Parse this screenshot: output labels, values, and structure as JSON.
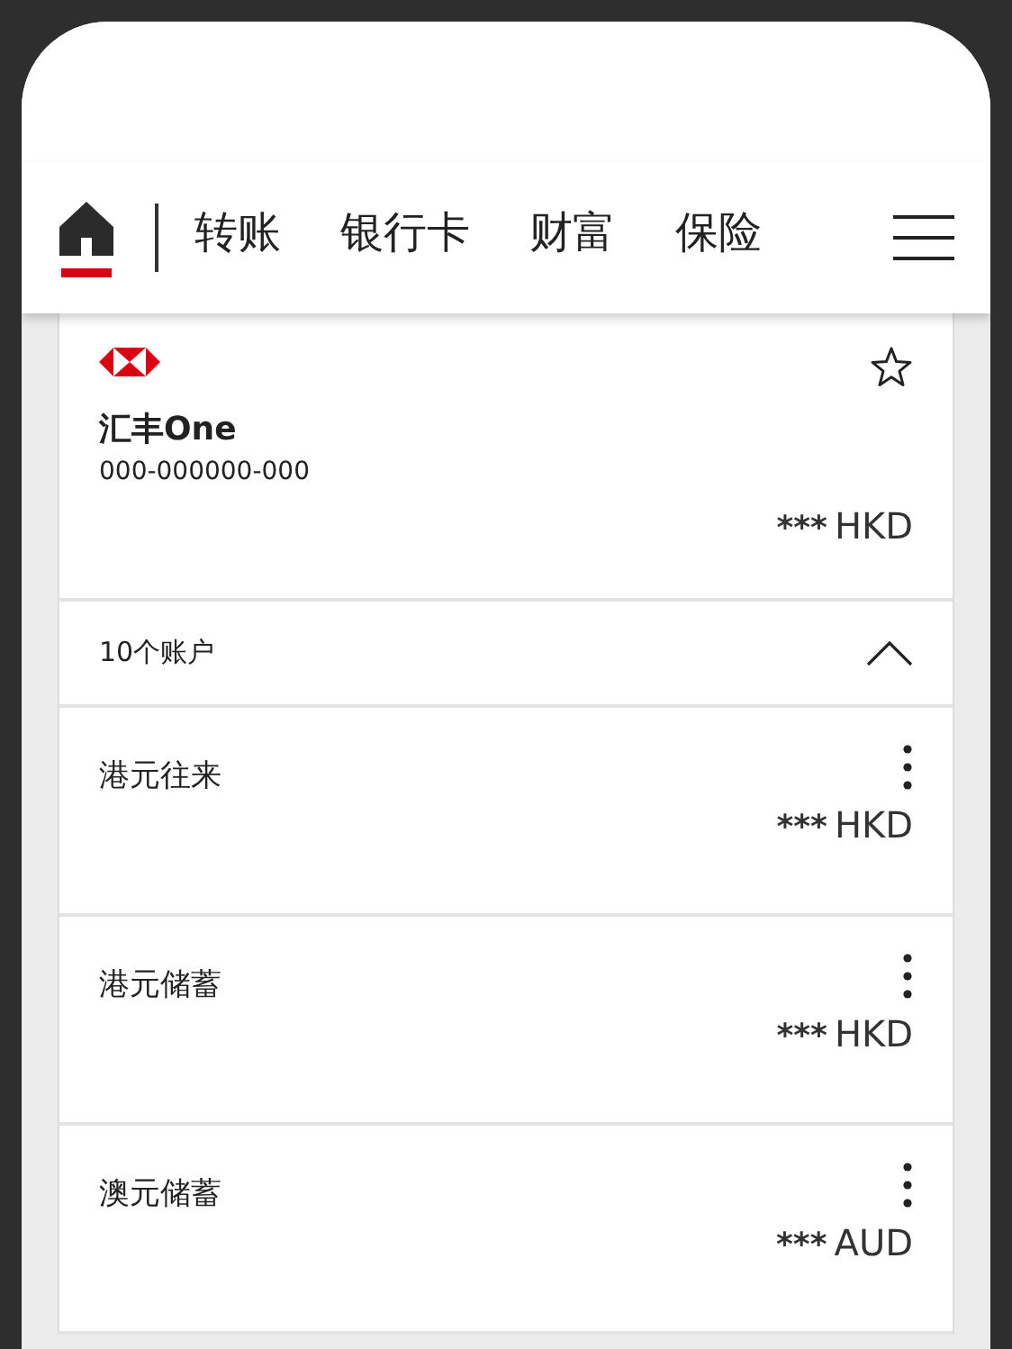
{
  "nav": {
    "tabs": [
      {
        "kind": "home",
        "selected": true
      },
      {
        "label": "转账",
        "selected": false
      },
      {
        "label": "银行卡",
        "selected": false
      },
      {
        "label": "财富",
        "selected": false
      },
      {
        "label": "保险",
        "selected": false
      }
    ]
  },
  "summary": {
    "name": "汇丰One",
    "number": "000-000000-000",
    "balance": "***",
    "currency": "HKD",
    "favorite": false
  },
  "accounts_header": {
    "label": "10个账户",
    "expanded": true
  },
  "accounts": [
    {
      "name": "港元往来",
      "balance": "***",
      "currency": "HKD"
    },
    {
      "name": "港元储蓄",
      "balance": "***",
      "currency": "HKD"
    },
    {
      "name": "澳元储蓄",
      "balance": "***",
      "currency": "AUD"
    }
  ]
}
